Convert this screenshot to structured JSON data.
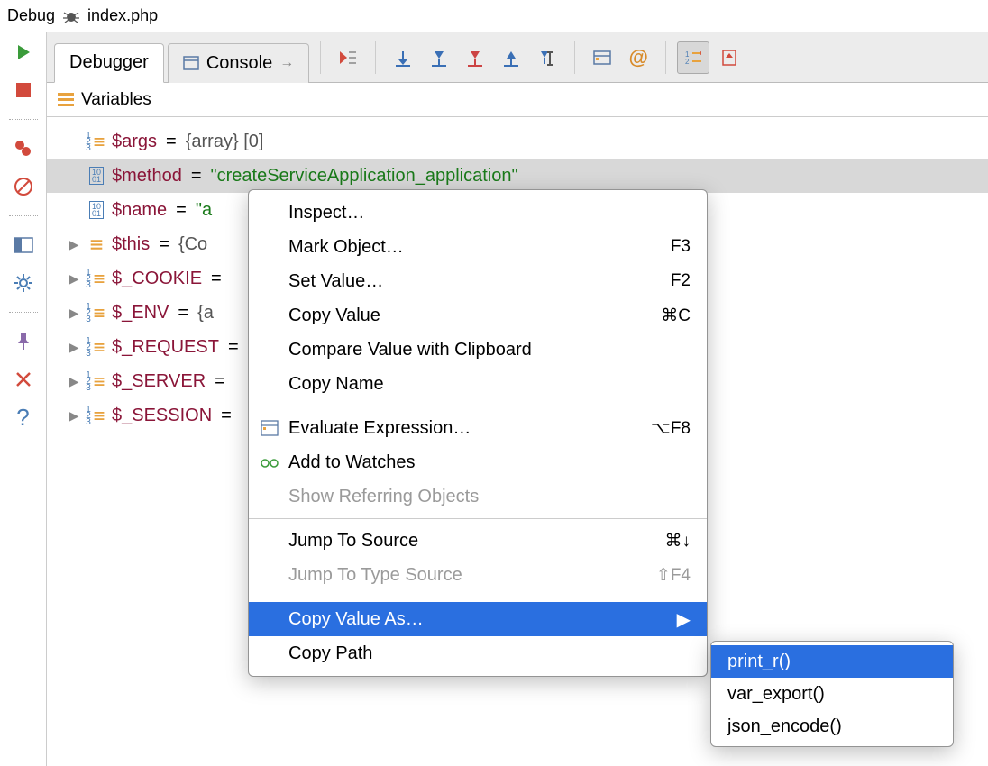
{
  "header": {
    "label": "Debug",
    "file": "index.php"
  },
  "tabs": {
    "debugger": "Debugger",
    "console": "Console"
  },
  "panel": {
    "title": "Variables"
  },
  "vars": [
    {
      "expand": "",
      "icon": "array",
      "name": "$args",
      "eq": "=",
      "val": "{array} [0]",
      "type": "brace"
    },
    {
      "expand": "",
      "icon": "bin",
      "name": "$method",
      "eq": "=",
      "val": "\"createServiceApplication_application\"",
      "type": "str",
      "selected": true
    },
    {
      "expand": "",
      "icon": "bin",
      "name": "$name",
      "eq": "=",
      "val": "\"a",
      "type": "str"
    },
    {
      "expand": "▶",
      "icon": "list",
      "name": "$this",
      "eq": "=",
      "val": "{Co",
      "type": "brace"
    },
    {
      "expand": "▶",
      "icon": "array",
      "name": "$_COOKIE",
      "eq": "=",
      "val": "",
      "type": "brace"
    },
    {
      "expand": "▶",
      "icon": "array",
      "name": "$_ENV",
      "eq": "=",
      "val": "{a",
      "type": "brace"
    },
    {
      "expand": "▶",
      "icon": "array",
      "name": "$_REQUEST",
      "eq": "=",
      "val": "",
      "type": "brace"
    },
    {
      "expand": "▶",
      "icon": "array",
      "name": "$_SERVER",
      "eq": "=",
      "val": "",
      "type": "brace"
    },
    {
      "expand": "▶",
      "icon": "array",
      "name": "$_SESSION",
      "eq": "=",
      "val": "",
      "type": "brace"
    }
  ],
  "menu": {
    "inspect": "Inspect…",
    "mark": "Mark Object…",
    "mark_sc": "F3",
    "setval": "Set Value…",
    "setval_sc": "F2",
    "copyval": "Copy Value",
    "copyval_sc": "⌘C",
    "compare": "Compare Value with Clipboard",
    "copyname": "Copy Name",
    "eval": "Evaluate Expression…",
    "eval_sc": "⌥F8",
    "watch": "Add to Watches",
    "refer": "Show Referring Objects",
    "jumpsrc": "Jump To Source",
    "jumpsrc_sc": "⌘↓",
    "jumptype": "Jump To Type Source",
    "jumptype_sc": "⇧F4",
    "copyas": "Copy Value As…",
    "copypath": "Copy Path"
  },
  "submenu": {
    "print_r": "print_r()",
    "var_export": "var_export()",
    "json_encode": "json_encode()"
  }
}
